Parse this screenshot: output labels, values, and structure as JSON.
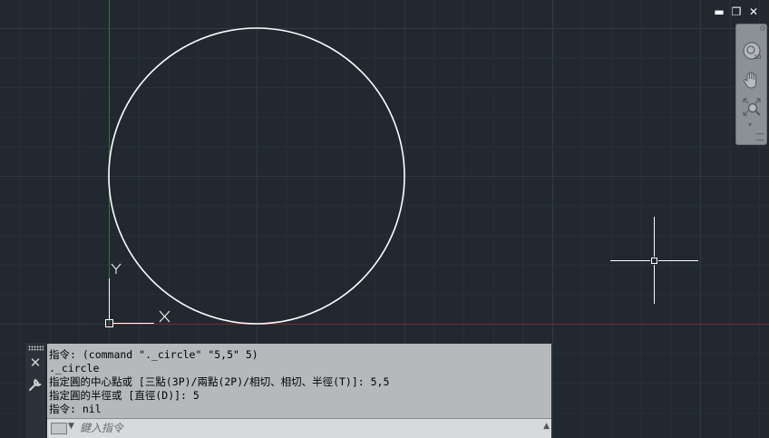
{
  "window_controls": {
    "minimize": "▬",
    "restore": "❐",
    "close": "✕"
  },
  "viewport": {
    "background": "#212830",
    "x_axis_color": "#8b2a2a",
    "y_axis_color": "#2b7a33",
    "circle": {
      "center": [
        5,
        5
      ],
      "radius": 5,
      "color": "#ffffff"
    },
    "ucs_icon": {
      "x_label": "X",
      "y_label": "Y"
    }
  },
  "navigation_bar": {
    "items": [
      "steering-wheel-icon",
      "pan-hand-icon",
      "zoom-extents-icon"
    ]
  },
  "command_line": {
    "history": [
      "指令: (command \"._circle\" \"5,5\" 5)",
      "._circle",
      "指定圓的中心點或 [三點(3P)/兩點(2P)/相切、相切、半徑(T)]: 5,5",
      "指定圓的半徑或 [直徑(D)]: 5",
      "指令: nil"
    ],
    "input_placeholder": "鍵入指令",
    "close_glyph": "✕"
  }
}
